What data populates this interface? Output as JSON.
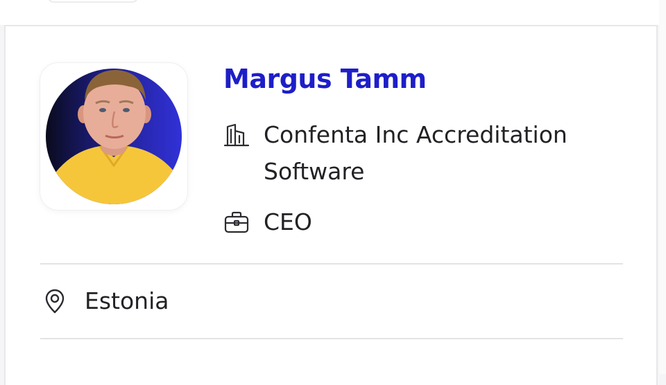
{
  "profile": {
    "name": "Margus Tamm",
    "company": "Confenta Inc Accreditation Software",
    "role": "CEO",
    "location": "Estonia"
  },
  "icons": {
    "company": "building-icon",
    "role": "briefcase-icon",
    "location": "location-pin-icon"
  },
  "colors": {
    "name_accent": "#1e1ec8",
    "text": "#222226",
    "avatar_background": "#2a2ad0",
    "shirt": "#f6c63a"
  }
}
